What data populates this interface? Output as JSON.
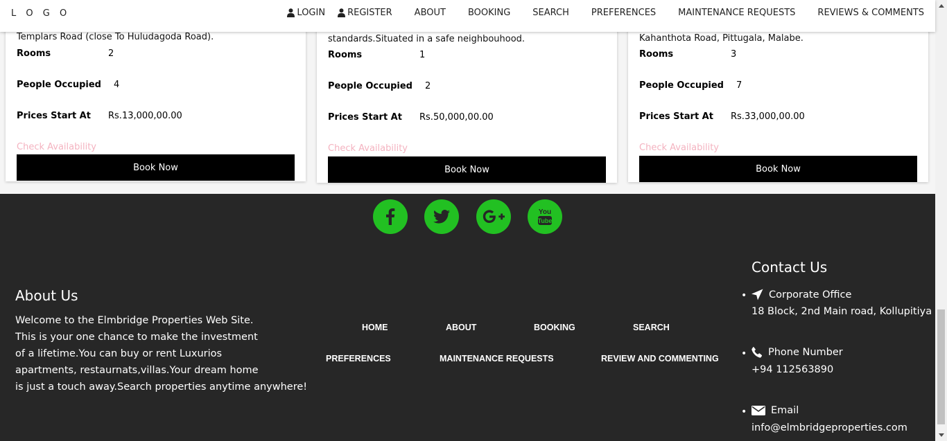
{
  "navbar": {
    "logo": "L O G O",
    "items": [
      {
        "label": "LOGIN",
        "icon": "user-icon"
      },
      {
        "label": "REGISTER",
        "icon": "user-icon"
      },
      {
        "label": "ABOUT"
      },
      {
        "label": "BOOKING"
      },
      {
        "label": "SEARCH"
      },
      {
        "label": "PREFERENCES"
      },
      {
        "label": "MAINTENANCE REQUESTS"
      },
      {
        "label": "REVIEWS & COMMENTS"
      }
    ]
  },
  "cards": [
    {
      "description": "Templars Road (close To Huludagoda Road).",
      "rooms_label": "Rooms",
      "rooms": "2",
      "people_label": "People Occupied",
      "people": "4",
      "price_label": "Prices Start At",
      "price": "Rs.13,000,00.00",
      "availability": "Check Availability",
      "book_label": "Book Now"
    },
    {
      "description": "standards.Situated in a safe neighbouhood.",
      "rooms_label": "Rooms",
      "rooms": "1",
      "people_label": "People Occupied",
      "people": "2",
      "price_label": "Prices Start At",
      "price": "Rs.50,000,00.00",
      "availability": "Check Availability",
      "book_label": "Book Now"
    },
    {
      "description": "Kahanthota Road, Pittugala, Malabe.",
      "rooms_label": "Rooms",
      "rooms": "3",
      "people_label": "People Occupied",
      "people": "7",
      "price_label": "Prices Start At",
      "price": "Rs.33,000,00.00",
      "availability": "Check Availability",
      "book_label": "Book Now"
    }
  ],
  "footer": {
    "social": [
      "facebook-icon",
      "twitter-icon",
      "google-plus-icon",
      "youtube-icon"
    ],
    "social_color": "#22c022",
    "background": "#272727",
    "about_title": "About Us",
    "about_lines": [
      "Welcome to the Elmbridge Properties Web Site.",
      "This is your one chance to make the investment",
      "of a lifetime.You can buy or rent Luxurios",
      "apartments, restaurnats,villas.Your dream home",
      "is just a touch away.Search properties anytime anywhere!"
    ],
    "links": {
      "home": "HOME",
      "about": "ABOUT",
      "booking": "BOOKING",
      "search": "SEARCH",
      "preferences": "PREFERENCES",
      "maintenance": "MAINTENANCE REQUESTS",
      "review": "REVIEW AND COMMENTING"
    },
    "contact_title": "Contact Us",
    "contact": {
      "office_label": "Corporate Office",
      "office_value": "18 Block, 2nd Main road, Kollupitiya",
      "phone_label": "Phone Number",
      "phone_value": "+94 112563890",
      "email_label": "Email",
      "email_value": "info@elmbridgeproperties.com"
    }
  }
}
